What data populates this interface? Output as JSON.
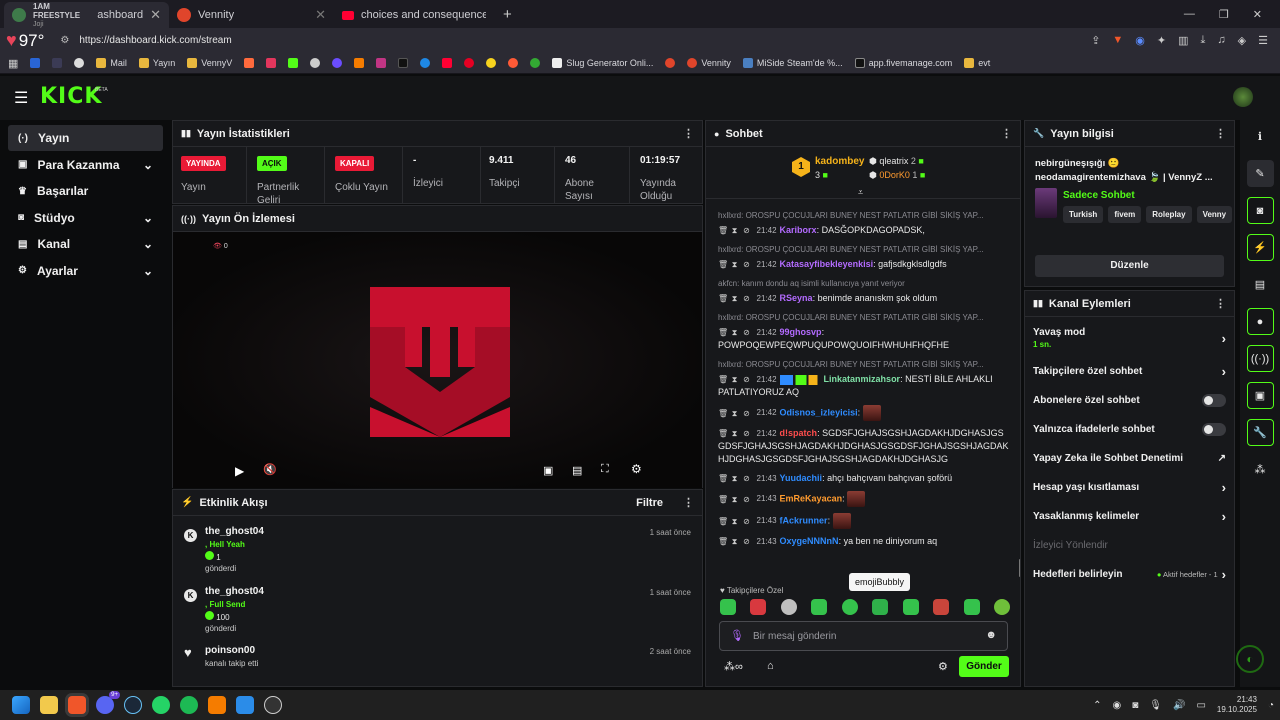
{
  "browser": {
    "tabs": [
      {
        "label": "1AM FREESTYLE",
        "sub": "Joji",
        "title": "ashboard",
        "active": true
      },
      {
        "label": "Vennity",
        "active": false
      },
      {
        "label": "choices and consequences - VennyZ",
        "active": false
      }
    ],
    "new_tab": "+",
    "temperature": "97°",
    "url": "https://dashboard.kick.com/stream",
    "bookmarks": [
      "Mail",
      "Yayın",
      "VennyV",
      "Slug Generator Onli...",
      "Vennity",
      "MiSide Steam'de %...",
      "app.fivemanage.com",
      "evt"
    ]
  },
  "header": {
    "logo": "KICK",
    "beta": "BETA"
  },
  "sidebar": {
    "items": [
      {
        "icon": "broadcast-icon",
        "label": "Yayın",
        "chevron": false,
        "active": true
      },
      {
        "icon": "monetize-icon",
        "label": "Para Kazanma",
        "chevron": true
      },
      {
        "icon": "trophy-icon",
        "label": "Başarılar",
        "chevron": false
      },
      {
        "icon": "studio-icon",
        "label": "Stüdyo",
        "chevron": true
      },
      {
        "icon": "channel-icon",
        "label": "Kanal",
        "chevron": true
      },
      {
        "icon": "settings-icon",
        "label": "Ayarlar",
        "chevron": true
      }
    ]
  },
  "stats": {
    "title": "Yayın İstatistikleri",
    "items": [
      {
        "badge": "YAYINDA",
        "badge_color": "#e91a36",
        "label": "Yayın"
      },
      {
        "badge": "AÇIK",
        "badge_color": "#53fc18",
        "label": "Partnerlik Geliri"
      },
      {
        "badge": "KAPALI",
        "badge_color": "#e91a36",
        "label": "Çoklu Yayın"
      },
      {
        "value": "-",
        "label": "İzleyici"
      },
      {
        "value": "9.411",
        "label": "Takipçi"
      },
      {
        "value": "46",
        "label": "Abone Sayısı"
      },
      {
        "value": "01:19:57",
        "label": "Yayında Olduğu"
      }
    ]
  },
  "preview": {
    "title": "Yayın Ön İzlemesi",
    "viewers": "0"
  },
  "activity": {
    "title": "Etkinlik Akışı",
    "filter": "Filtre",
    "items": [
      {
        "user": "the_ghost04",
        "line1": ", Hell Yeah",
        "amount": "1",
        "line3": "gönderdi",
        "time": "1 saat önce"
      },
      {
        "user": "the_ghost04",
        "line1": ", Full Send",
        "amount": "100",
        "line3": "gönderdi",
        "time": "1 saat önce"
      },
      {
        "user": "poinson00",
        "line1": "kanalı takip etti",
        "time": "2 saat önce"
      }
    ]
  },
  "chat": {
    "title": "Sohbet",
    "leaderboard": {
      "first": "kadombey",
      "first_count": "3",
      "second": "qleatrix",
      "second_count": "2",
      "third": "0DorK0",
      "third_count": "1",
      "rank": "1"
    },
    "messages": [
      {
        "reply": "hxllxrd: OROSPU ÇOCUJLARI BUNEY NEST PATLATIR GİBİ SİKİŞ YAP...",
        "time": "21:42",
        "user": "Kariborx",
        "color": "#b36bff",
        "text": "DASĞOPKDAGOPADSK,"
      },
      {
        "reply": "hxllxrd: OROSPU ÇOCUJLARI BUNEY NEST PATLATIR GİBİ SİKİŞ YAP...",
        "time": "21:42",
        "user": "Katasayfibekleyenkisi",
        "color": "#b36bff",
        "text": "gafjsdkgklsdlgdfs"
      },
      {
        "reply": "akfcn: kanım dondu aq isimli kullanıcıya yanıt veriyor",
        "time": "21:42",
        "user": "RSeyna",
        "color": "#b36bff",
        "text": "benimde ananıskm şok oldum"
      },
      {
        "reply": "hxllxrd: OROSPU ÇOCUJLARI BUNEY NEST PATLATIR GİBİ SİKİŞ YAP...",
        "time": "21:42",
        "user": "99ghosvp",
        "color": "#b36bff",
        "text": "POWPOQEWPEQWPUQUPOWQUOIFHWHUHFHQFHE"
      },
      {
        "reply": "hxllxrd: OROSPU ÇOCUJLARI BUNEY NEST PATLATIR GİBİ SİKİŞ YAP...",
        "time": "21:42",
        "user": "Linkatanmizahsor",
        "color": "#7fe0a6",
        "text": "NESTİ BİLE AHLAKLI PATLATIYORUZ AQ"
      },
      {
        "time": "21:42",
        "user": "Odisnos_izleyicisi",
        "color": "#2f8cff",
        "text": ""
      },
      {
        "time": "21:42",
        "user": "d!spatch",
        "color": "#ff4d4d",
        "text": "SGDSFJGHAJSGSHJAGDAKHJDGHASJGSGDSFJGHAJSGSHJAGDAKHJDGHASJGSGDSFJGHAJSGSHJAGDAKHJDGHASJGSGDSFJGHAJSGSHJAGDAKHJDGHASJG"
      },
      {
        "time": "21:43",
        "user": "Yuudachii",
        "color": "#2f8cff",
        "text": "ahçı bahçıvanı bahçıvan şoförü"
      },
      {
        "time": "21:43",
        "user": "EmReKayacan",
        "color": "#ff9b2f",
        "text": ""
      },
      {
        "time": "21:43",
        "user": "fAckrunner",
        "color": "#2f8cff",
        "text": ""
      },
      {
        "time": "21:43",
        "user": "OxygeNNNnN",
        "color": "#2f8cff",
        "text": "ya ben ne diniyorum aq"
      }
    ],
    "tooltip": "emojiBubbly",
    "followers_only": "Takipçilere Özel",
    "input_placeholder": "Bir mesaj gönderin",
    "send": "Gönder"
  },
  "stream_info": {
    "title": "Yayın bilgisi",
    "stream_title": "nebirgüneşışığı 🙂 neodamagirentemizhava 🍃 | VennyZ ...",
    "category": "Sadece Sohbet",
    "tags": [
      "Turkish",
      "fivem",
      "Roleplay",
      "Venny"
    ],
    "edit": "Düzenle"
  },
  "channel_actions": {
    "title": "Kanal Eylemleri",
    "slow_mode": "Yavaş mod",
    "slow_value": "1 sn.",
    "followers_chat": "Takipçilere özel sohbet",
    "subs_chat": "Abonelere özel sohbet",
    "emote_chat": "Yalnızca ifadelerle sohbet",
    "ai_mod": "Yapay Zeka ile Sohbet Denetimi",
    "age": "Hesap yaşı kısıtlaması",
    "banned": "Yasaklanmış kelimeler",
    "viewer_redirect": "İzleyici Yönlendir",
    "goals": "Hedefleri belirleyin",
    "goals_status": "Aktif hedefler - 1"
  },
  "taskbar": {
    "time": "21:43",
    "date": "19.10.2025",
    "badge": "9+"
  },
  "colors": {
    "accent": "#53fc18",
    "live": "#e91a36",
    "panel": "#17181b"
  }
}
